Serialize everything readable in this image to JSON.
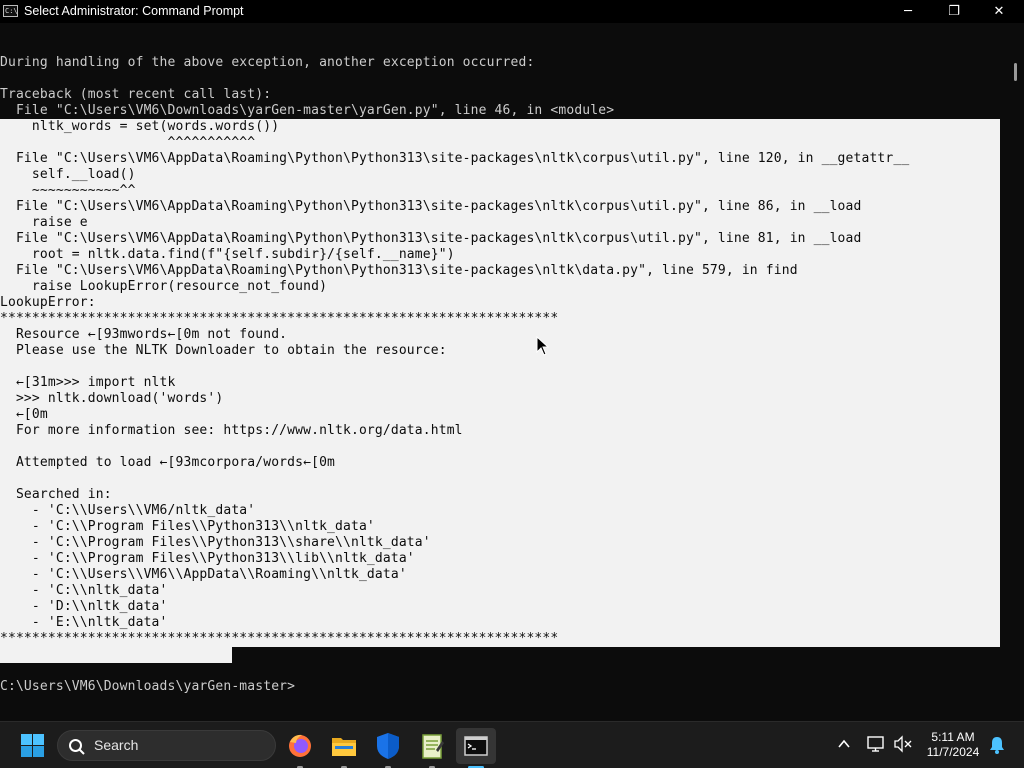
{
  "window": {
    "title": "Select Administrator: Command Prompt",
    "app_icon_text": "C:\\",
    "minimize_label": "─",
    "maximize_label": "❐",
    "close_label": "✕"
  },
  "console": {
    "lines": [
      "",
      "",
      "During handling of the above exception, another exception occurred:",
      "",
      "Traceback (most recent call last):",
      "  File \"C:\\Users\\VM6\\Downloads\\yarGen-master\\yarGen.py\", line 46, in <module>",
      "    nltk_words = set(words.words())",
      "                     ^^^^^^^^^^^",
      "  File \"C:\\Users\\VM6\\AppData\\Roaming\\Python\\Python313\\site-packages\\nltk\\corpus\\util.py\", line 120, in __getattr__",
      "    self.__load()",
      "    ~~~~~~~~~~~^^",
      "  File \"C:\\Users\\VM6\\AppData\\Roaming\\Python\\Python313\\site-packages\\nltk\\corpus\\util.py\", line 86, in __load",
      "    raise e",
      "  File \"C:\\Users\\VM6\\AppData\\Roaming\\Python\\Python313\\site-packages\\nltk\\corpus\\util.py\", line 81, in __load",
      "    root = nltk.data.find(f\"{self.subdir}/{self.__name}\")",
      "  File \"C:\\Users\\VM6\\AppData\\Roaming\\Python\\Python313\\site-packages\\nltk\\data.py\", line 579, in find",
      "    raise LookupError(resource_not_found)",
      "LookupError:",
      "**********************************************************************",
      "  Resource ←[93mwords←[0m not found.",
      "  Please use the NLTK Downloader to obtain the resource:",
      "",
      "  ←[31m>>> import nltk",
      "  >>> nltk.download('words')",
      "  ←[0m",
      "  For more information see: https://www.nltk.org/data.html",
      "",
      "  Attempted to load ←[93mcorpora/words←[0m",
      "",
      "  Searched in:",
      "    - 'C:\\\\Users\\\\VM6/nltk_data'",
      "    - 'C:\\\\Program Files\\\\Python313\\\\nltk_data'",
      "    - 'C:\\\\Program Files\\\\Python313\\\\share\\\\nltk_data'",
      "    - 'C:\\\\Program Files\\\\Python313\\\\lib\\\\nltk_data'",
      "    - 'C:\\\\Users\\\\VM6\\\\AppData\\\\Roaming\\\\nltk_data'",
      "    - 'C:\\\\nltk_data'",
      "    - 'D:\\\\nltk_data'",
      "    - 'E:\\\\nltk_data'",
      "**********************************************************************",
      "",
      "",
      "C:\\Users\\VM6\\Downloads\\yarGen-master>"
    ],
    "selected_line_start": 6,
    "selected_line_end": 39
  },
  "taskbar": {
    "search_label": "Search",
    "apps": [
      "start-icon",
      "firefox-icon",
      "file-explorer-icon",
      "windows-defender-icon",
      "notepad-icon",
      "terminal-icon"
    ],
    "active_app": "terminal-icon",
    "clock_time": "5:11 AM",
    "clock_date": "11/7/2024"
  },
  "colors": {
    "console_bg": "#0c0c0c",
    "console_fg": "#cccccc",
    "selection_bg": "#f2f2f2",
    "taskbar_bg": "#1c1c1c",
    "accent": "#4cc2ff"
  }
}
